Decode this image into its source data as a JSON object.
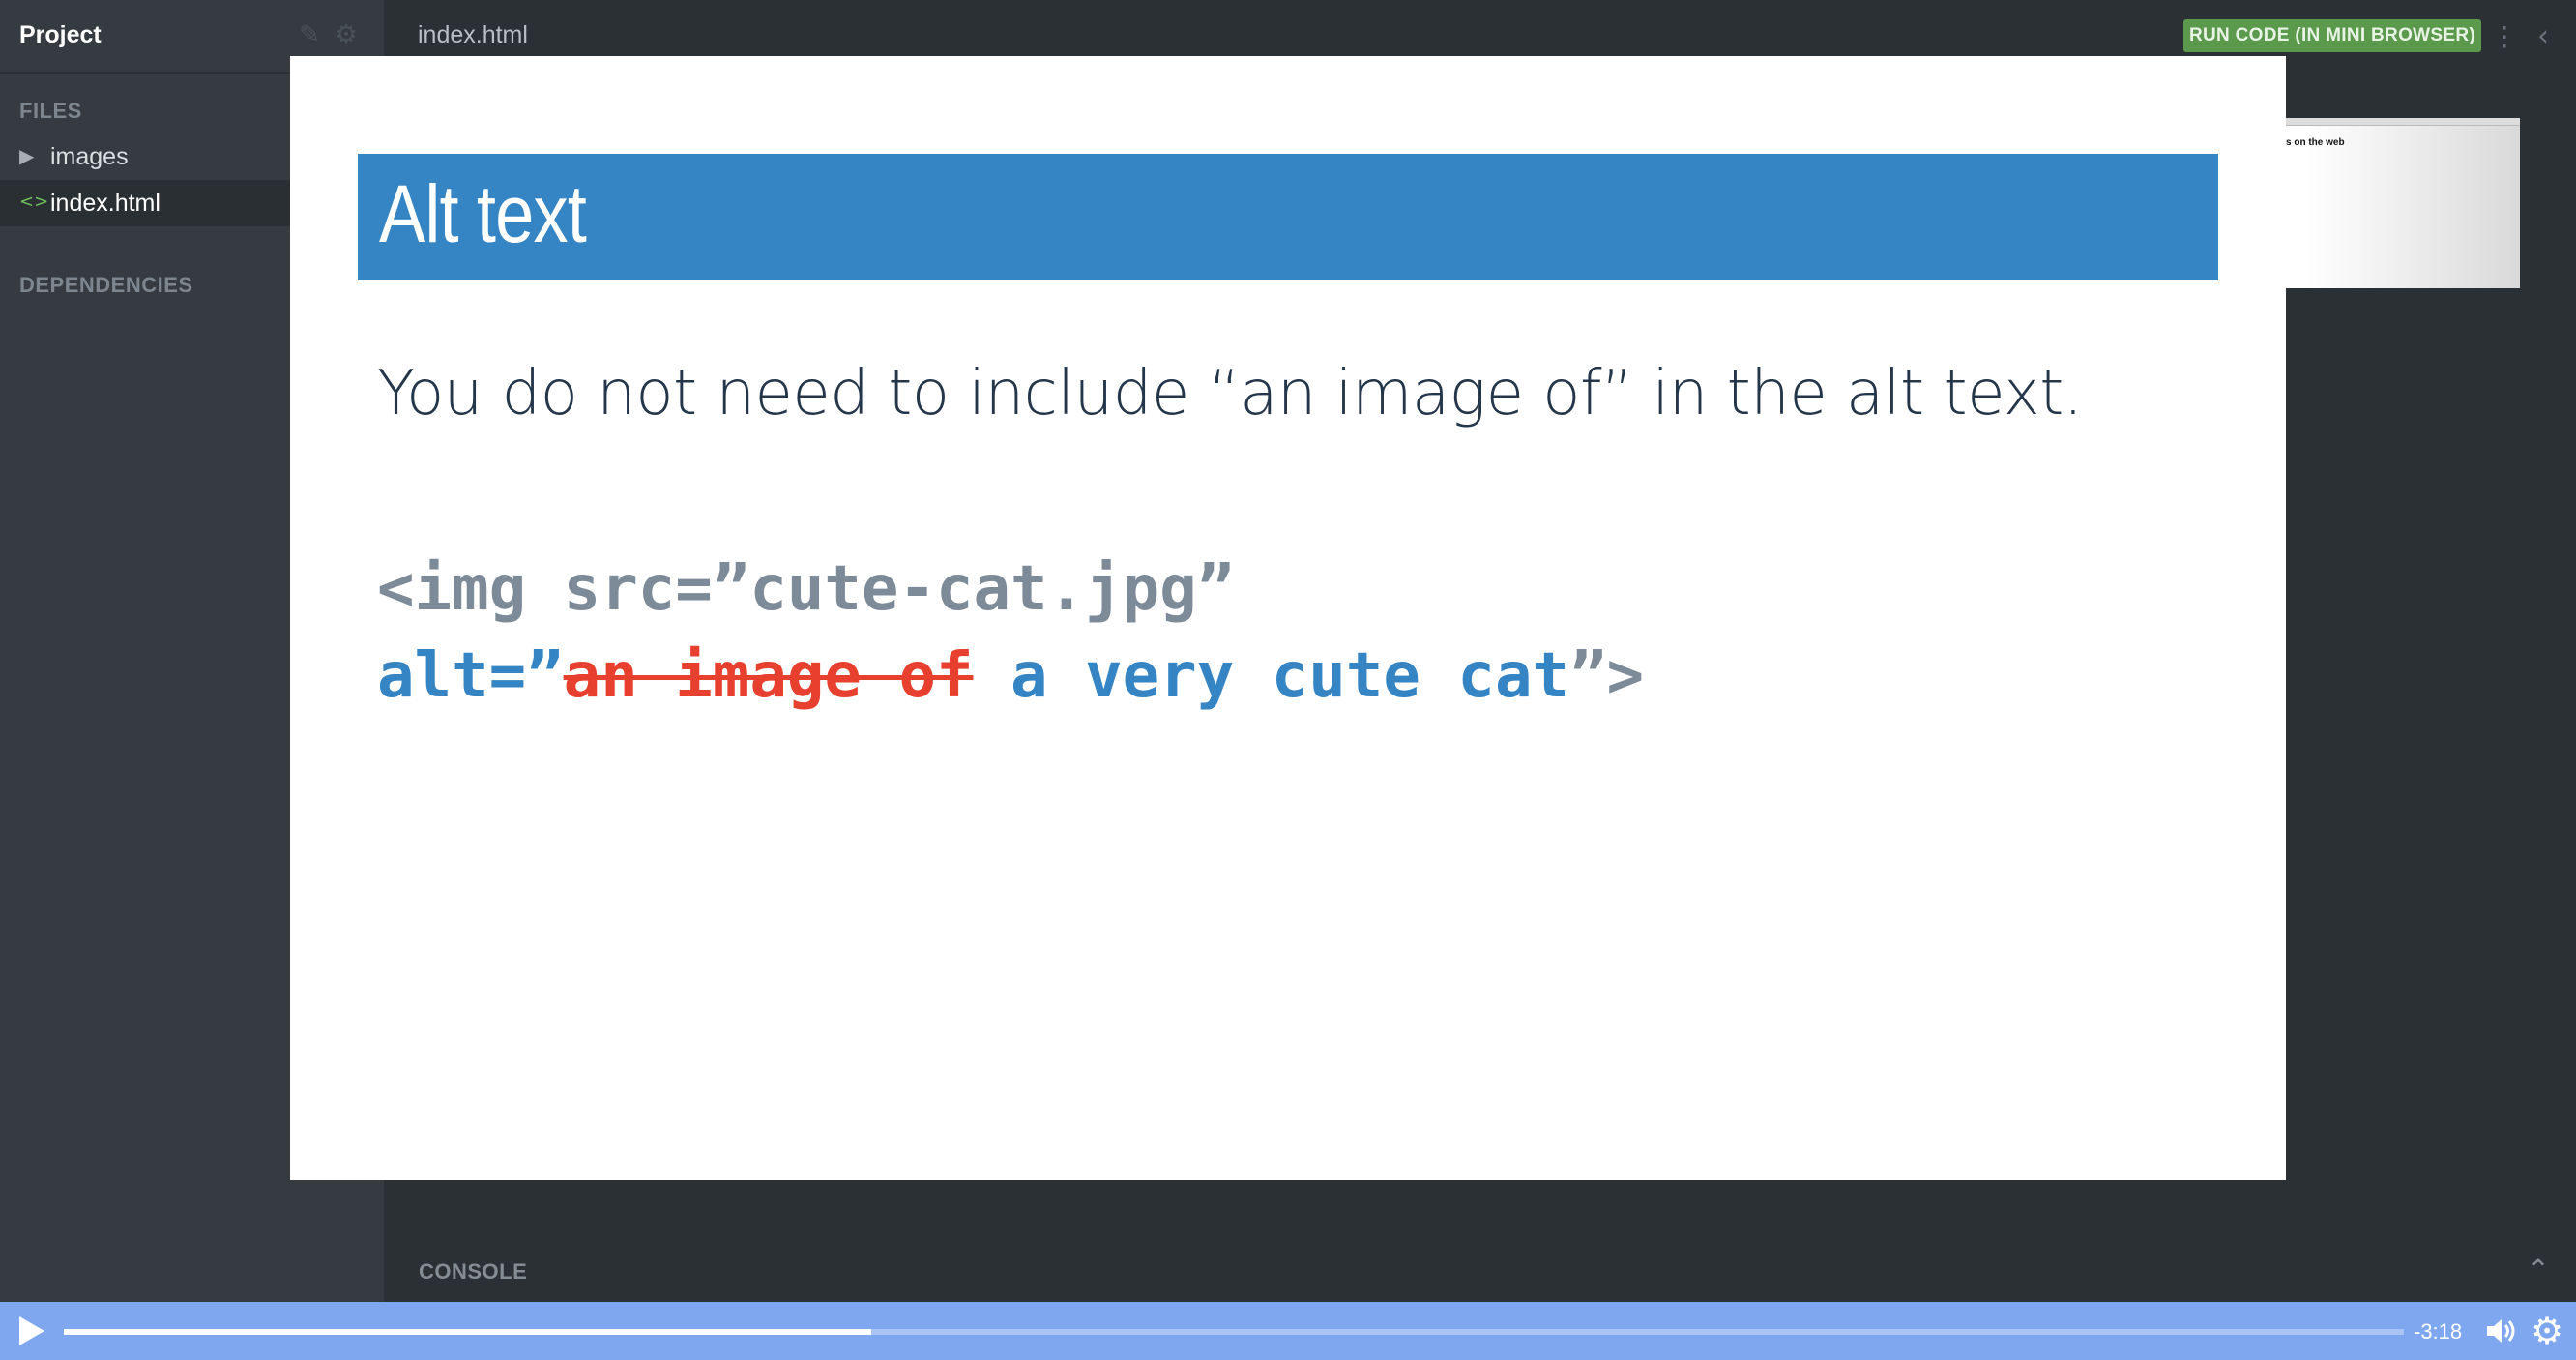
{
  "sidebar": {
    "project_title": "Project",
    "edit_icon": "pencil-icon",
    "settings_icon": "gear-icon",
    "files_label": "FILES",
    "items": [
      {
        "label": "images",
        "icon": "triangle-right-icon"
      },
      {
        "label": "index.html",
        "icon": "code-brackets-icon"
      }
    ],
    "dependencies_label": "DEPENDENCIES"
  },
  "editor": {
    "tab_label": "index.html",
    "run_button_label": "RUN CODE (IN MINI BROWSER)",
    "menu_icon": "vertical-dots-icon",
    "collapse_icon": "chevron-left-icon"
  },
  "preview": {
    "text": "s on the web"
  },
  "console": {
    "label": "CONSOLE",
    "toggle_icon": "chevron-up-icon"
  },
  "slide": {
    "title": "Alt text",
    "body": "You do not need to include “an image of” in the alt text.",
    "code_line1": "<img src=”cute-cat.jpg”",
    "code_line2_start": "alt=”",
    "code_line2_strike": "an image of",
    "code_line2_mid": " a very cute cat",
    "code_line2_end": "”>"
  },
  "video": {
    "time_remaining": "-3:18",
    "progress": 0.345,
    "play_icon": "play-icon",
    "volume_icon": "volume-icon",
    "settings_icon": "gear-icon"
  },
  "colors": {
    "banner": "#3585c4",
    "strike": "#e8402f",
    "run_button": "#5b9a4c",
    "video_bar": "#7ea7f0"
  }
}
